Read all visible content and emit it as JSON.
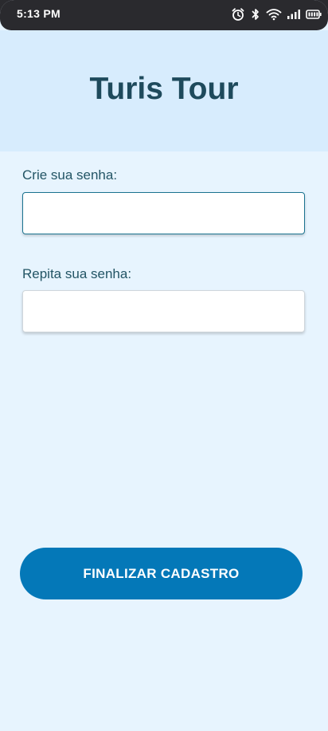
{
  "status_bar": {
    "time": "5:13 PM",
    "icons": [
      "alarm-icon",
      "bluetooth-icon",
      "wifi-icon",
      "cellular-signal-icon",
      "battery-icon"
    ]
  },
  "header": {
    "title": "Turis Tour"
  },
  "form": {
    "password_label": "Crie sua senha:",
    "password_value": "",
    "repeat_label": "Repita sua senha:",
    "repeat_value": ""
  },
  "actions": {
    "submit_label": "FINALIZAR CADASTRO"
  },
  "colors": {
    "background": "#e7f4fe",
    "header_background": "#d7ecfd",
    "title": "#1e4a5c",
    "button": "#0478b8",
    "status_bar": "#2a2a2e"
  }
}
